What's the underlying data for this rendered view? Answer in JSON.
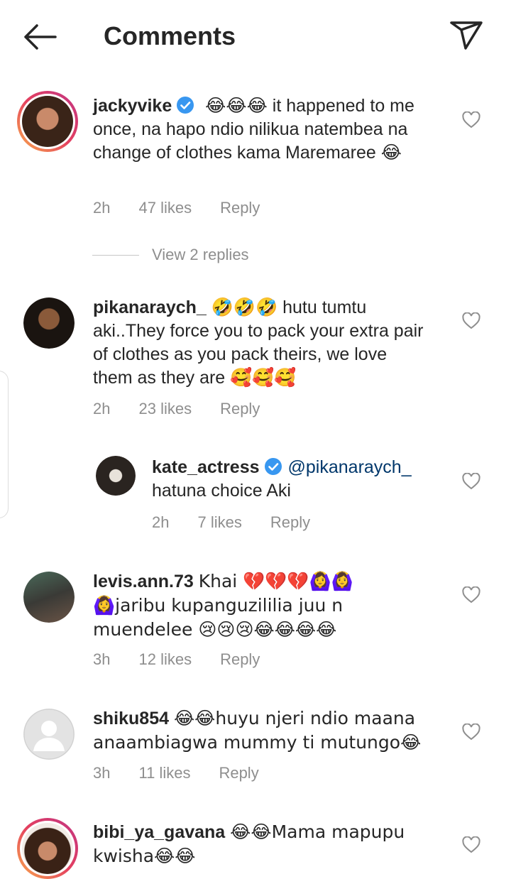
{
  "header": {
    "title": "Comments",
    "back_icon": "arrow-left-icon",
    "send_icon": "paper-plane-icon"
  },
  "comments": [
    {
      "username": "jackyvike",
      "verified": true,
      "emoji_prefix": "😂😂😂",
      "text": "it happened to me once, na hapo ndio nilikua natembea na change of clothes kama Maremaree 😂",
      "time": "2h",
      "likes": "47 likes",
      "reply": "Reply",
      "view_replies": "View 2 replies"
    },
    {
      "username": "pikanaraych_",
      "verified": false,
      "emoji_prefix": "🤣🤣🤣",
      "text": "hutu tumtu aki..They force you to pack your extra pair of clothes as you pack theirs, we love them as they are 🥰🥰🥰",
      "time": "2h",
      "likes": "23 likes",
      "reply": "Reply"
    },
    {
      "username": "kate_actress",
      "verified": true,
      "mention": "@pikanaraych_",
      "text": "hatuna choice Aki",
      "time": "2h",
      "likes": "7 likes",
      "reply": "Reply"
    },
    {
      "username": "levis.ann.73",
      "verified": false,
      "text_line1": "Khai 💔💔💔🙆‍♀️🙆‍♀️",
      "text_rest": "🙆‍♀️jaribu kupanguzililia juu n muendelee 😢😢😢😂😂😂😂",
      "time": "3h",
      "likes": "12 likes",
      "reply": "Reply"
    },
    {
      "username": "shiku854",
      "verified": false,
      "text": "😂😂huyu njeri ndio maana anaambiagwa mummy ti mutungo😂",
      "time": "3h",
      "likes": "11 likes",
      "reply": "Reply"
    },
    {
      "username": "bibi_ya_gavana",
      "verified": false,
      "text": "😂😂Mama mapupu kwisha😂😂"
    }
  ],
  "colors": {
    "text": "#262626",
    "meta": "#8e8e8e",
    "mention": "#00376b",
    "verified": "#3897f0"
  }
}
